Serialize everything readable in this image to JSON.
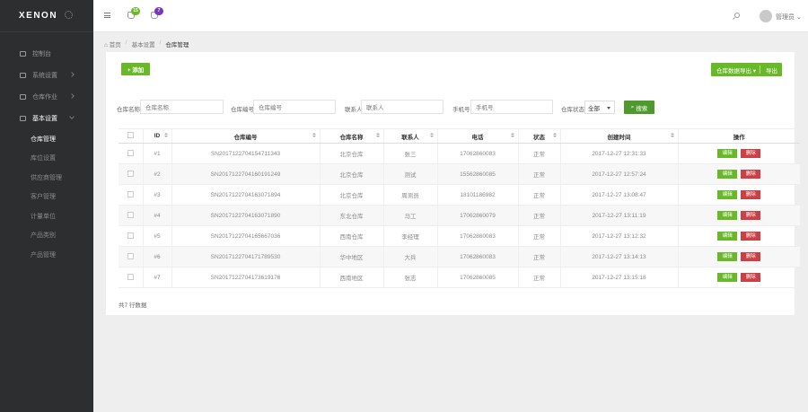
{
  "app": {
    "logo": "XENON"
  },
  "topbar": {
    "notif1_badge": "15",
    "notif1_color": "#68b828",
    "notif2_badge": "7",
    "notif2_color": "#7c38bc",
    "username": "管理员"
  },
  "sidebar": {
    "items": [
      {
        "label": "控制台",
        "icon": "dashboard-icon",
        "expandable": false
      },
      {
        "label": "系统设置",
        "icon": "monitor-icon",
        "expandable": true
      },
      {
        "label": "仓库作业",
        "icon": "warehouse-icon",
        "expandable": true
      },
      {
        "label": "基本设置",
        "icon": "gear-icon",
        "expandable": true,
        "open": true
      }
    ],
    "subitems": [
      {
        "label": "仓库管理",
        "active": true
      },
      {
        "label": "库位设置",
        "active": false
      },
      {
        "label": "供应商管理",
        "active": false
      },
      {
        "label": "客户管理",
        "active": false
      },
      {
        "label": "计量单位",
        "active": false
      },
      {
        "label": "产品类别",
        "active": false
      },
      {
        "label": "产品管理",
        "active": false
      }
    ]
  },
  "breadcrumb": {
    "home": "首页",
    "parent": "基本设置",
    "current": "仓库管理"
  },
  "toolbar": {
    "add_label": "+ 添加",
    "export_label": "仓库数据导出 ▾",
    "export_split": "导出"
  },
  "filters": {
    "name_label": "仓库名称",
    "name_placeholder": "仓库名称",
    "code_label": "仓库编号",
    "code_placeholder": "仓库编号",
    "contact_label": "联系人",
    "contact_placeholder": "联系人",
    "phone_label": "手机号",
    "phone_placeholder": "手机号",
    "status_label": "仓库状态",
    "status_value": "全部",
    "search_label": "搜索"
  },
  "table": {
    "headers": [
      "",
      "ID",
      "仓库编号",
      "仓库名称",
      "联系人",
      "电话",
      "状态",
      "创建时间",
      "操作"
    ],
    "rows": [
      {
        "id": "#1",
        "code": "SN2017122704154711343",
        "name": "北京仓库",
        "contact": "张三",
        "phone": "17062860083",
        "status": "正常",
        "created": "2017-12-27 12:31:33"
      },
      {
        "id": "#2",
        "code": "SN2017122704160191249",
        "name": "北京仓库",
        "contact": "测试",
        "phone": "15562860085",
        "status": "正常",
        "created": "2017-12-27 12:57:24"
      },
      {
        "id": "#3",
        "code": "SN2017122704163071894",
        "name": "北京仓库",
        "contact": "周测员",
        "phone": "18101186982",
        "status": "正常",
        "created": "2017-12-27 13:08:47"
      },
      {
        "id": "#4",
        "code": "SN2017122704163071890",
        "name": "东北仓库",
        "contact": "马工",
        "phone": "17062860079",
        "status": "正常",
        "created": "2017-12-27 13:11:19"
      },
      {
        "id": "#5",
        "code": "SN2017122704165667036",
        "name": "西南仓库",
        "contact": "李经理",
        "phone": "17062860083",
        "status": "正常",
        "created": "2017-12-27 13:12:32"
      },
      {
        "id": "#6",
        "code": "SN2017122704171789530",
        "name": "华中地区",
        "contact": "大兵",
        "phone": "17062860083",
        "status": "正常",
        "created": "2017-12-27 13:14:13"
      },
      {
        "id": "#7",
        "code": "SN2017122704173619176",
        "name": "西南地区",
        "contact": "张志",
        "phone": "17062860085",
        "status": "正常",
        "created": "2017-12-27 13:15:18"
      }
    ],
    "edit_label": "编辑",
    "delete_label": "删除"
  },
  "summary": "共7 行数据"
}
